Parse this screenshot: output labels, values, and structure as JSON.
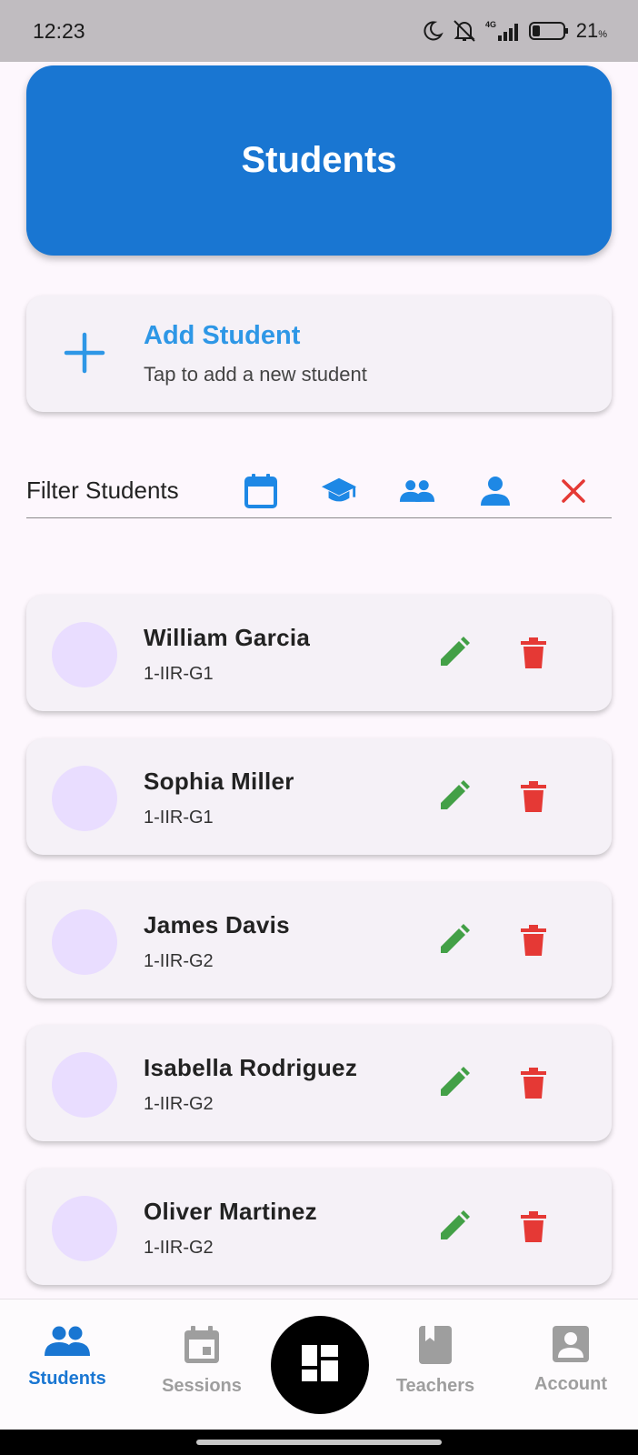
{
  "status_bar": {
    "time": "12:23",
    "network": "4G",
    "battery": "21",
    "battery_unit": "%"
  },
  "header": {
    "title": "Students"
  },
  "add_card": {
    "title": "Add Student",
    "subtitle": "Tap to add a new student",
    "icon": "plus-icon"
  },
  "filter": {
    "label": "Filter Students",
    "buttons": [
      "calendar-icon",
      "graduation-cap-icon",
      "group-icon",
      "person-icon",
      "close-icon"
    ]
  },
  "students": [
    {
      "name": "William Garcia",
      "group": "1-IIR-G1"
    },
    {
      "name": "Sophia Miller",
      "group": "1-IIR-G1"
    },
    {
      "name": "James Davis",
      "group": "1-IIR-G2"
    },
    {
      "name": "Isabella Rodriguez",
      "group": "1-IIR-G2"
    },
    {
      "name": "Oliver Martinez",
      "group": "1-IIR-G2"
    }
  ],
  "nav": {
    "items": [
      {
        "label": "Students",
        "icon": "group-icon",
        "active": true
      },
      {
        "label": "Sessions",
        "icon": "calendar-icon",
        "active": false
      },
      {
        "label": "Teachers",
        "icon": "book-icon",
        "active": false
      },
      {
        "label": "Account",
        "icon": "account-box-icon",
        "active": false
      }
    ],
    "fab_icon": "dashboard-icon"
  },
  "colors": {
    "primary": "#1976d2",
    "accent_blue": "#2e97e6",
    "edit_green": "#43a047",
    "delete_red": "#e53935",
    "avatar_bg": "#e9ddff",
    "card_bg": "#f5f1f7"
  }
}
